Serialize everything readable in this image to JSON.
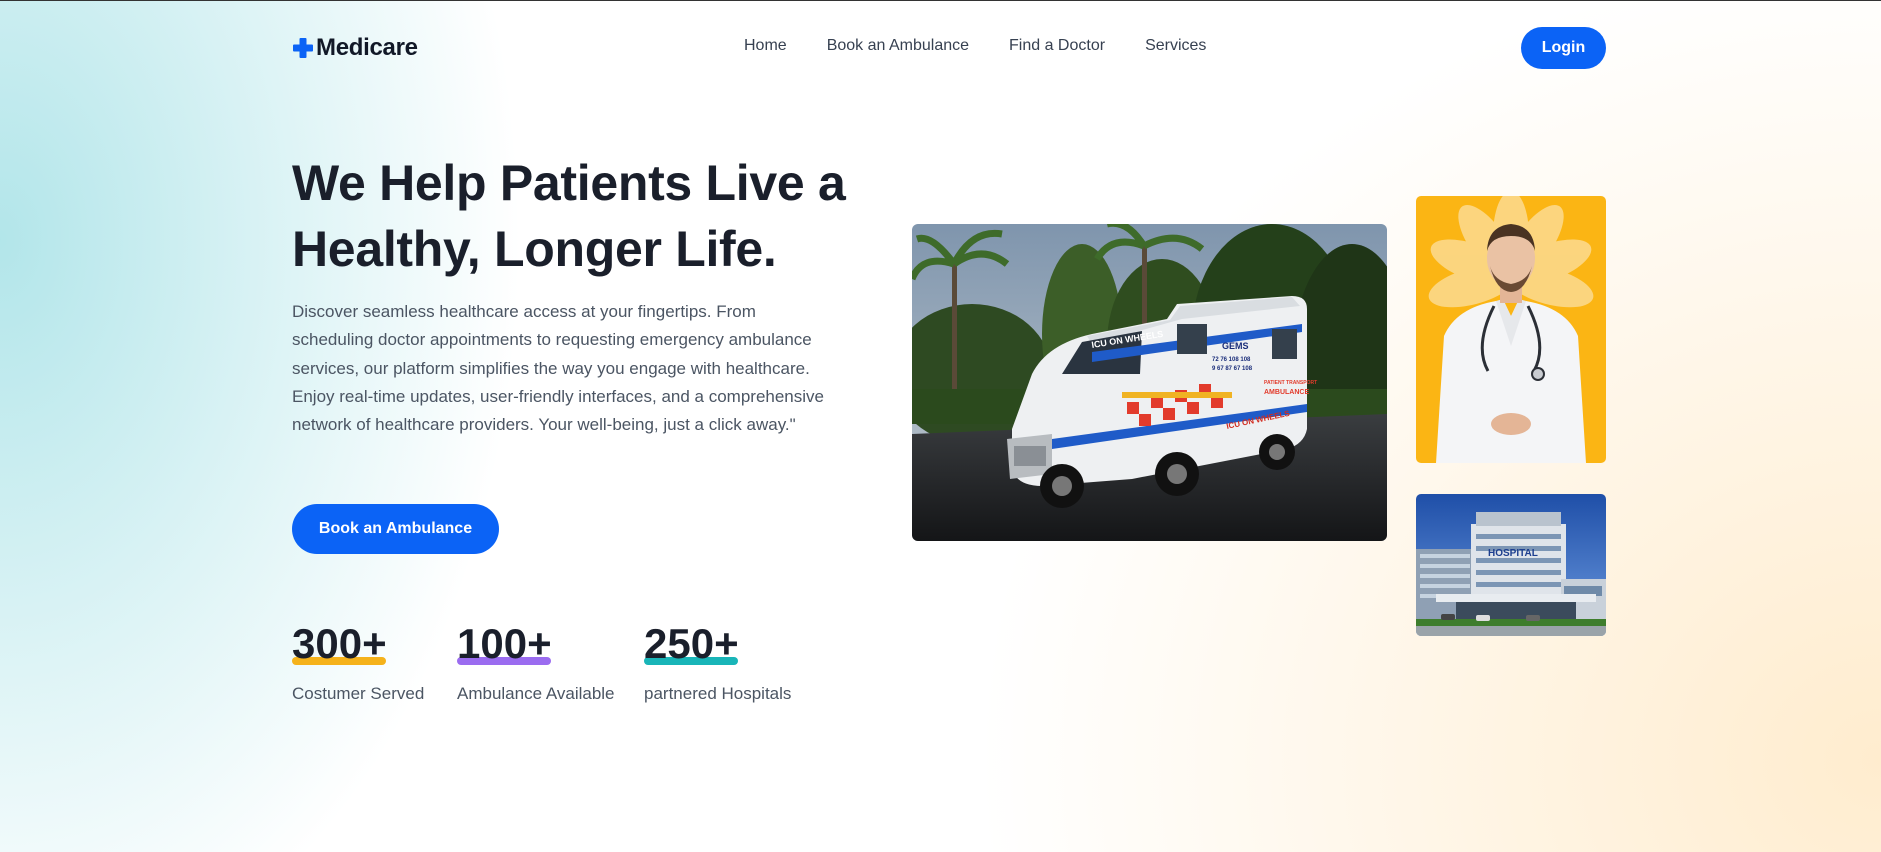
{
  "brand": {
    "name": "Medicare",
    "accent": "#0b63f6"
  },
  "nav": {
    "items": [
      {
        "label": "Home"
      },
      {
        "label": "Book an Ambulance"
      },
      {
        "label": "Find a Doctor"
      },
      {
        "label": "Services"
      }
    ],
    "login_label": "Login"
  },
  "hero": {
    "title": "We Help Patients Live a Healthy, Longer Life.",
    "description": "Discover seamless healthcare access at your fingertips. From scheduling doctor appointments to requesting emergency ambulance services, our platform simplifies the way you engage with healthcare. Enjoy real-time updates, user-friendly interfaces, and a comprehensive network of healthcare providers. Your well-being, just a click away.\"",
    "cta_label": "Book an Ambulance"
  },
  "stats": [
    {
      "value": "300+",
      "label": "Costumer Served",
      "accent": "#f5b21b"
    },
    {
      "value": "100+",
      "label": "Ambulance Available",
      "accent": "#9b6cf0"
    },
    {
      "value": "250+",
      "label": "partnered Hospitals",
      "accent": "#19b5b8"
    }
  ],
  "images": {
    "ambulance_text": [
      "ICU ON WHEELS",
      "GEMS",
      "72 76 108 108",
      "9 67 87 67 108",
      "PATIENT TRANSPORT",
      "AMBULANCE",
      "ICU ON WHEELS"
    ],
    "hospital_sign": "HOSPITAL"
  }
}
